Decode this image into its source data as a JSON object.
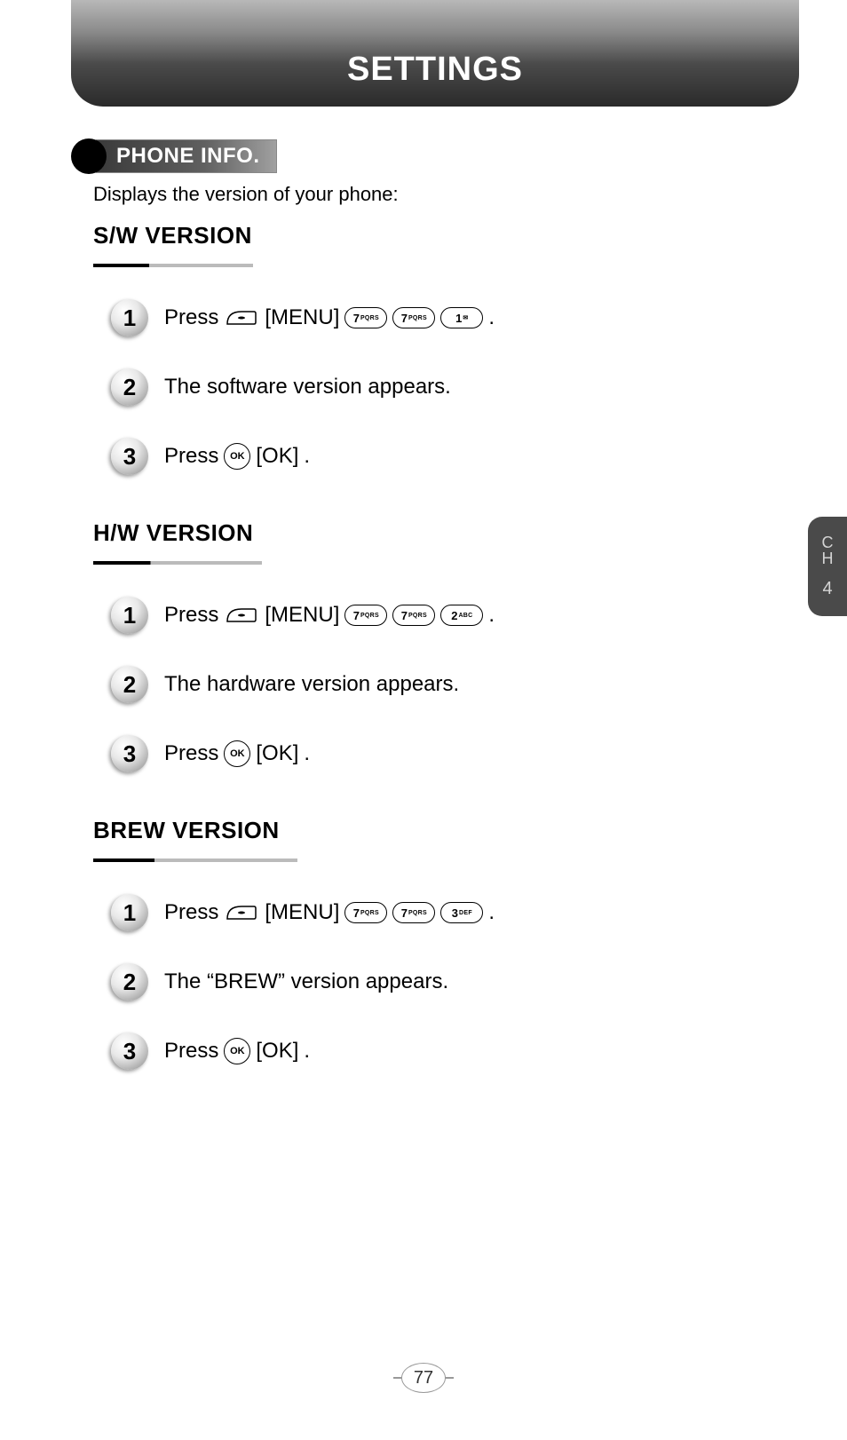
{
  "header": {
    "title": "SETTINGS"
  },
  "section": {
    "label": "PHONE INFO."
  },
  "intro": "Displays the version of your phone:",
  "side_tab": {
    "line1": "C",
    "line2": "H",
    "num": "4"
  },
  "page_number": "77",
  "keys": {
    "menu": "[MENU]",
    "ok_label": "[OK]",
    "ok_circle": "OK",
    "k7_main": "7",
    "k7_sub": "PQRS",
    "k1_main": "1",
    "k2_main": "2",
    "k2_sub": "ABC",
    "k3_main": "3",
    "k3_sub": "DEF"
  },
  "subsections": [
    {
      "title": "S/W VERSION",
      "steps": [
        {
          "num": "1",
          "prefix": "Press",
          "seq": [
            "soft",
            "menu",
            "k7",
            "k7",
            "k1"
          ],
          "suffix": "."
        },
        {
          "num": "2",
          "text": "The software version appears."
        },
        {
          "num": "3",
          "prefix": "Press",
          "seq": [
            "ok",
            "oklabel"
          ],
          "suffix": "."
        }
      ]
    },
    {
      "title": "H/W VERSION",
      "steps": [
        {
          "num": "1",
          "prefix": "Press",
          "seq": [
            "soft",
            "menu",
            "k7",
            "k7",
            "k2"
          ],
          "suffix": "."
        },
        {
          "num": "2",
          "text": "The hardware version appears."
        },
        {
          "num": "3",
          "prefix": "Press",
          "seq": [
            "ok",
            "oklabel"
          ],
          "suffix": "."
        }
      ]
    },
    {
      "title": "BREW VERSION",
      "steps": [
        {
          "num": "1",
          "prefix": "Press",
          "seq": [
            "soft",
            "menu",
            "k7",
            "k7",
            "k3"
          ],
          "suffix": "."
        },
        {
          "num": "2",
          "text": "The “BREW” version appears."
        },
        {
          "num": "3",
          "prefix": "Press",
          "seq": [
            "ok",
            "oklabel"
          ],
          "suffix": "."
        }
      ]
    }
  ]
}
